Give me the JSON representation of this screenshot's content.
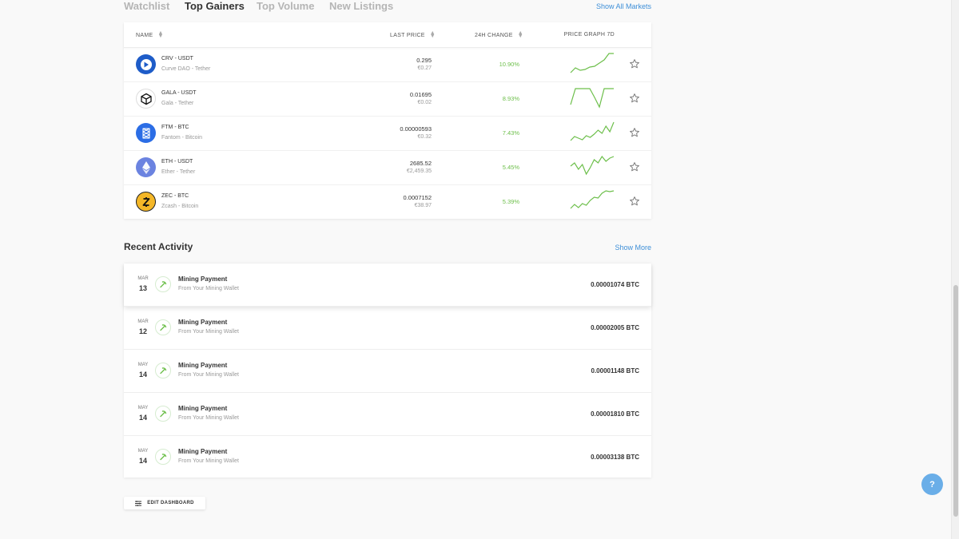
{
  "tabs": [
    "Watchlist",
    "Top Gainers",
    "Top Volume",
    "New Listings"
  ],
  "active_tab": 1,
  "show_all_markets": "Show All Markets",
  "market_table": {
    "headers": {
      "name": "NAME",
      "price": "LAST PRICE",
      "change": "24H CHANGE",
      "graph": "PRICE GRAPH 7D"
    },
    "rows": [
      {
        "pair": "CRV - USDT",
        "names": "Curve DAO - Tether",
        "price": "0.295",
        "price_eur": "€0.27",
        "change": "10.90%",
        "icon": "curve-dao-icon",
        "color": "#1e5cc8",
        "spark": [
          2,
          8,
          5,
          6,
          9,
          10,
          14,
          18,
          26,
          26
        ]
      },
      {
        "pair": "GALA - USDT",
        "names": "Gala - Tether",
        "price": "0.01695",
        "price_eur": "€0.02",
        "change": "8.93%",
        "icon": "gala-icon",
        "color": "#ffffff",
        "spark": [
          5,
          25,
          25,
          25,
          25,
          14,
          2,
          25,
          25,
          25
        ]
      },
      {
        "pair": "FTM - BTC",
        "names": "Fantom - Bitcoin",
        "price": "0.00000593",
        "price_eur": "€0.32",
        "change": "7.43%",
        "icon": "fantom-icon",
        "color": "#2b6de5",
        "spark": [
          3,
          8,
          6,
          4,
          9,
          7,
          11,
          16,
          12,
          21,
          14,
          26
        ]
      },
      {
        "pair": "ETH - USDT",
        "names": "Ether - Tether",
        "price": "2685.52",
        "price_eur": "€2,459.35",
        "change": "5.45%",
        "icon": "ethereum-icon",
        "color": "#6b83e0",
        "spark": [
          14,
          18,
          10,
          16,
          4,
          12,
          22,
          18,
          26,
          20,
          24,
          26
        ]
      },
      {
        "pair": "ZEC - BTC",
        "names": "Zcash - Bitcoin",
        "price": "0.0007152",
        "price_eur": "€38.97",
        "change": "5.39%",
        "icon": "zcash-icon",
        "color": "#f4b728",
        "spark": [
          4,
          9,
          5,
          10,
          8,
          14,
          18,
          17,
          23,
          26,
          25,
          26
        ]
      }
    ]
  },
  "recent_activity": {
    "title": "Recent Activity",
    "show_more": "Show More",
    "items": [
      {
        "month": "MAR",
        "day": "13",
        "title": "Mining Payment",
        "sub": "From Your Mining Wallet",
        "amount": "0.00001074 BTC"
      },
      {
        "month": "MAR",
        "day": "12",
        "title": "Mining Payment",
        "sub": "From Your Mining Wallet",
        "amount": "0.00002005 BTC"
      },
      {
        "month": "MAY",
        "day": "14",
        "title": "Mining Payment",
        "sub": "From Your Mining Wallet",
        "amount": "0.00001148 BTC"
      },
      {
        "month": "MAY",
        "day": "14",
        "title": "Mining Payment",
        "sub": "From Your Mining Wallet",
        "amount": "0.00001810 BTC"
      },
      {
        "month": "MAY",
        "day": "14",
        "title": "Mining Payment",
        "sub": "From Your Mining Wallet",
        "amount": "0.00003138 BTC"
      }
    ]
  },
  "edit_dashboard": "EDIT DASHBOARD",
  "help": "?",
  "colors": {
    "accent": "#3e8fd8",
    "positive": "#6dbf4b",
    "help": "#6aaee8"
  }
}
